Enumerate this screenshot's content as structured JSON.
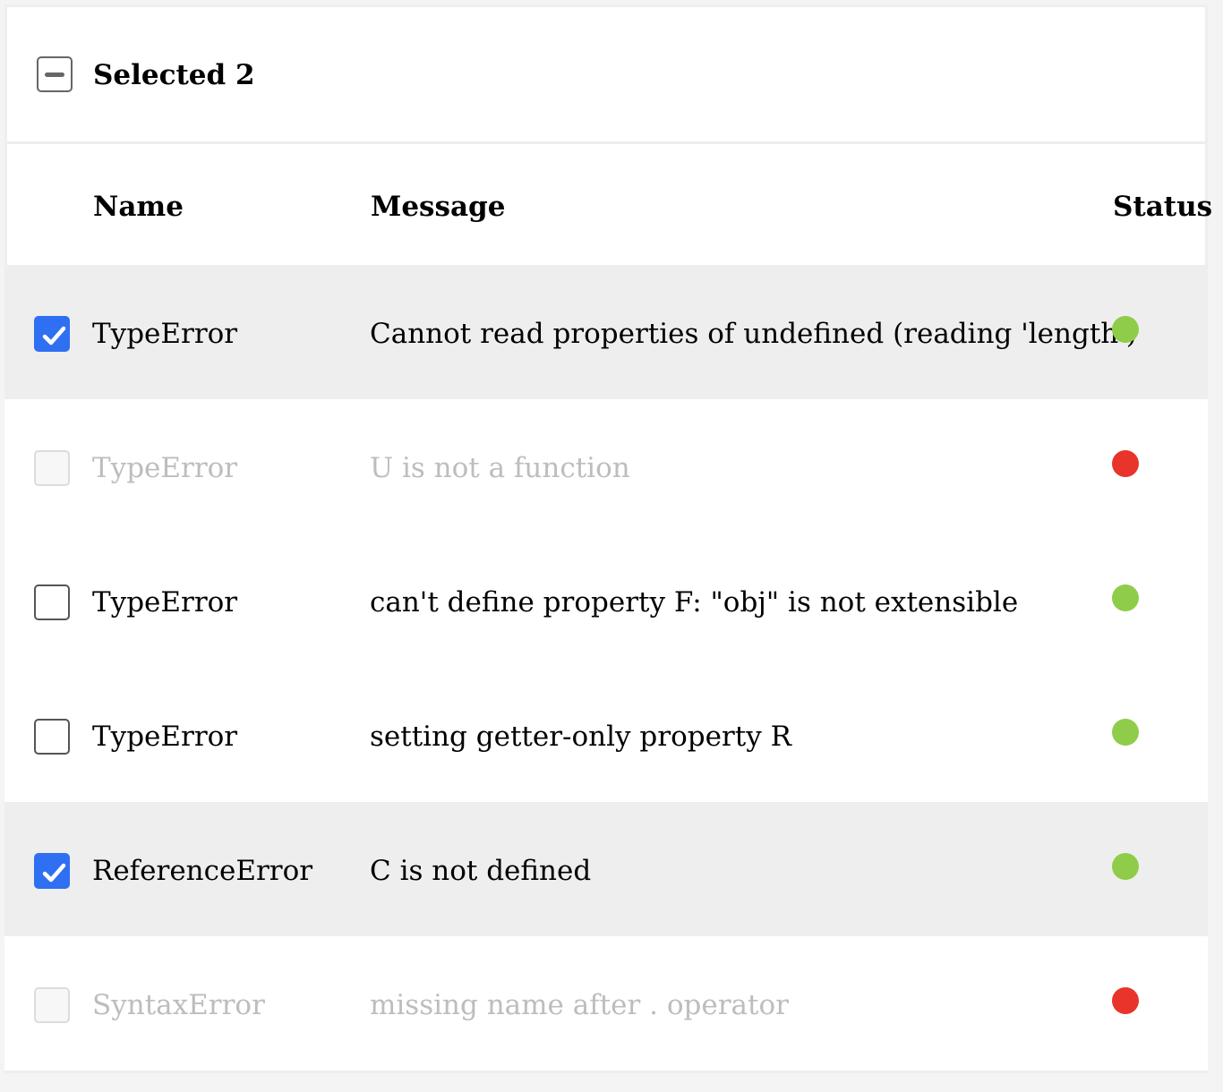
{
  "toolbar": {
    "selected_label": "Selected 2"
  },
  "columns": {
    "name": "Name",
    "message": "Message",
    "status": "Status"
  },
  "colors": {
    "checkbox_checked": "#2f6ff2",
    "status_ok": "#8fcc4a",
    "status_error": "#e8342a",
    "row_selected_bg": "#eeeeee",
    "disabled_text": "#bdbdbd"
  },
  "rows": [
    {
      "name": "TypeError",
      "message": "Cannot read properties of undefined (reading 'length')",
      "status": "ok",
      "checked": true,
      "disabled": false
    },
    {
      "name": "TypeError",
      "message": "U is not a function",
      "status": "error",
      "checked": false,
      "disabled": true
    },
    {
      "name": "TypeError",
      "message": "can't define property F: \"obj\" is not extensible",
      "status": "ok",
      "checked": false,
      "disabled": false
    },
    {
      "name": "TypeError",
      "message": "setting getter-only property R",
      "status": "ok",
      "checked": false,
      "disabled": false
    },
    {
      "name": "ReferenceError",
      "message": "C is not defined",
      "status": "ok",
      "checked": true,
      "disabled": false
    },
    {
      "name": "SyntaxError",
      "message": "missing name after . operator",
      "status": "error",
      "checked": false,
      "disabled": true
    }
  ]
}
